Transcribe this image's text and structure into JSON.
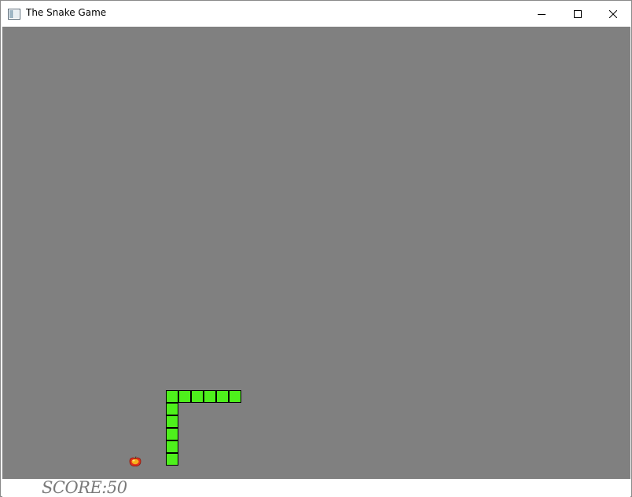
{
  "window": {
    "title": "The Snake Game",
    "minimize_icon": "minimize-icon",
    "maximize_icon": "maximize-icon",
    "close_icon": "close-icon",
    "app_icon": "window-app-icon"
  },
  "game": {
    "background_color": "#808080",
    "snake_color": "#4ef01c",
    "snake_border_color": "#000000",
    "snake_length": 11,
    "food_icon": "apple-icon",
    "score_text": "SCORE:50",
    "score_color": "#7a7a7a"
  }
}
